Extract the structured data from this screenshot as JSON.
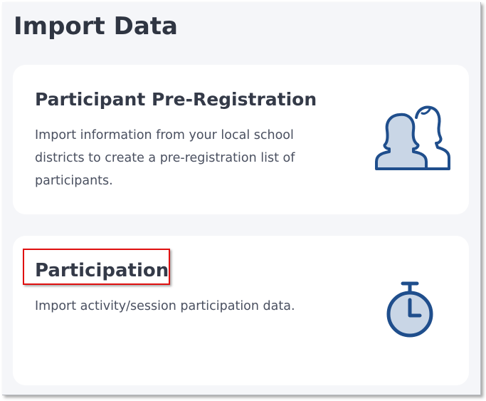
{
  "page": {
    "title": "Import Data"
  },
  "cards": [
    {
      "title": "Participant Pre-Registration",
      "description": "Import information from your local school districts to create a pre-registration list of participants.",
      "icon": "users-icon"
    },
    {
      "title": "Participation",
      "description": "Import activity/session participation data.",
      "icon": "stopwatch-icon"
    }
  ],
  "colors": {
    "icon_stroke": "#1f4e8c",
    "icon_fill": "#c9d6e6",
    "highlight": "#e01010",
    "title_text": "#343a48",
    "body_text": "#4a5060"
  }
}
